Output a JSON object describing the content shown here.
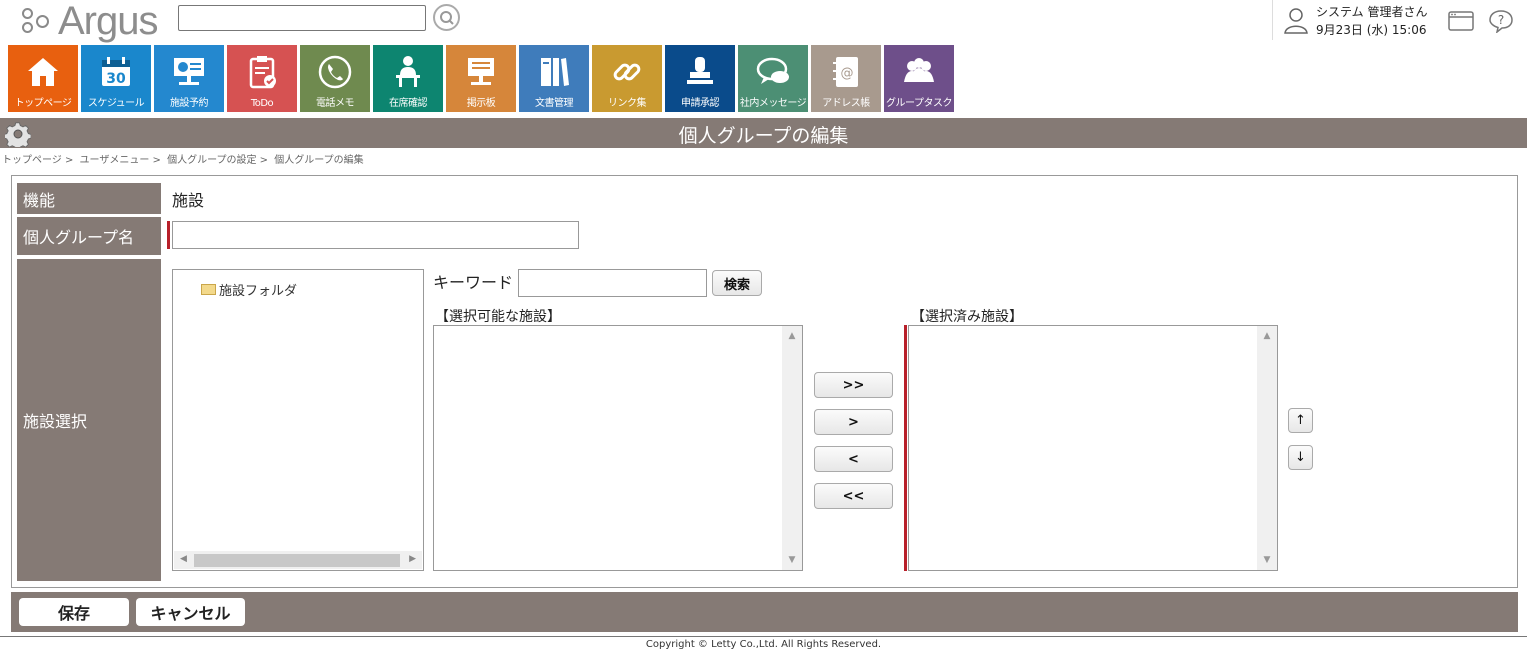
{
  "header": {
    "logo_text": "Argus",
    "search_value": "",
    "user_name": "システム 管理者さん",
    "date_time": "9月23日 (水) 15:06"
  },
  "nav": [
    {
      "label": "トップページ",
      "color": "#e8600f",
      "icon": "home-icon"
    },
    {
      "label": "スケジュール",
      "color": "#1a87cc",
      "icon": "calendar-icon"
    },
    {
      "label": "施設予約",
      "color": "#2488cf",
      "icon": "facility-icon"
    },
    {
      "label": "ToDo",
      "color": "#d65252",
      "icon": "todo-icon"
    },
    {
      "label": "電話メモ",
      "color": "#6f8a4f",
      "icon": "phone-icon"
    },
    {
      "label": "在席確認",
      "color": "#0d8570",
      "icon": "presence-icon"
    },
    {
      "label": "掲示板",
      "color": "#d6863a",
      "icon": "board-icon"
    },
    {
      "label": "文書管理",
      "color": "#3f7cbb",
      "icon": "document-icon"
    },
    {
      "label": "リンク集",
      "color": "#c99a30",
      "icon": "link-icon"
    },
    {
      "label": "申請承認",
      "color": "#0a4b8b",
      "icon": "stamp-icon"
    },
    {
      "label": "社内メッセージ",
      "color": "#4c8f74",
      "icon": "message-icon"
    },
    {
      "label": "アドレス帳",
      "color": "#a89a8e",
      "icon": "address-book-icon"
    },
    {
      "label": "グループタスク",
      "color": "#6e4f8a",
      "icon": "group-task-icon"
    }
  ],
  "page": {
    "title": "個人グループの編集",
    "breadcrumb": [
      "トップページ >",
      "ユーザメニュー >",
      "個人グループの設定 >",
      "個人グループの編集"
    ]
  },
  "form": {
    "function_label": "機能",
    "function_value": "施設",
    "group_name_label": "個人グループ名",
    "group_name_value": "",
    "facility_select_label": "施設選択",
    "tree_folder": "施設フォルダ",
    "keyword_label": "キーワード",
    "keyword_value": "",
    "search_button": "検索",
    "available_title": "【選択可能な施設】",
    "selected_title": "【選択済み施設】",
    "move_all_right": ">>",
    "move_right": ">",
    "move_left": "<",
    "move_all_left": "<<",
    "order_up": "↑",
    "order_down": "↓"
  },
  "footer": {
    "save_label": "保存",
    "cancel_label": "キャンセル",
    "copyright": "Copyright © Letty Co.,Ltd. All Rights Reserved."
  }
}
